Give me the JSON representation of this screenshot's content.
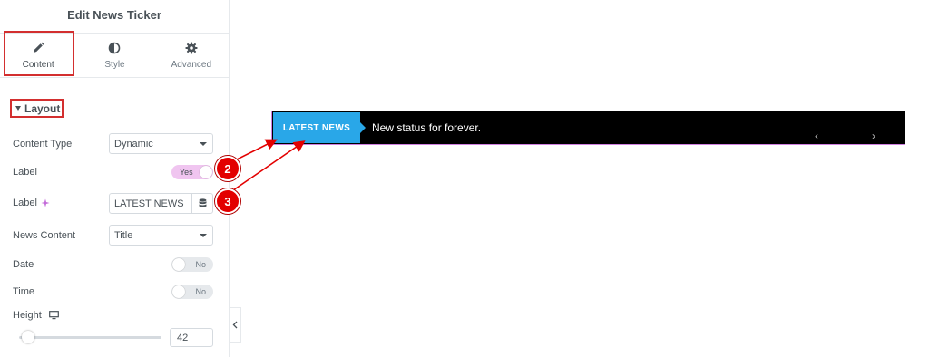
{
  "panel": {
    "title": "Edit News Ticker",
    "tabs": [
      {
        "label": "Content",
        "icon": "pencil-icon"
      },
      {
        "label": "Style",
        "icon": "half-circle-icon"
      },
      {
        "label": "Advanced",
        "icon": "gear-icon"
      }
    ],
    "active_tab": "Content",
    "section_title": "Layout",
    "controls": {
      "content_type": {
        "label": "Content Type",
        "value": "Dynamic"
      },
      "label_switch": {
        "label": "Label",
        "value": "Yes"
      },
      "label_text": {
        "label": "Label",
        "value": "LATEST NEWS"
      },
      "news_content": {
        "label": "News Content",
        "value": "Title"
      },
      "date": {
        "label": "Date",
        "value": "No"
      },
      "time": {
        "label": "Time",
        "value": "No"
      },
      "height": {
        "label": "Height",
        "value": "42"
      }
    }
  },
  "ticker": {
    "label": "LATEST NEWS",
    "text": "New status for forever.",
    "prev": "‹",
    "next": "›"
  },
  "annotations": {
    "marker_2": "2",
    "marker_3": "3"
  },
  "colors": {
    "accent_pink": "#f0c5f0",
    "highlight_red": "#d32f2f",
    "ticker_label_blue": "#29a7e8",
    "marker_red": "#e30000"
  }
}
